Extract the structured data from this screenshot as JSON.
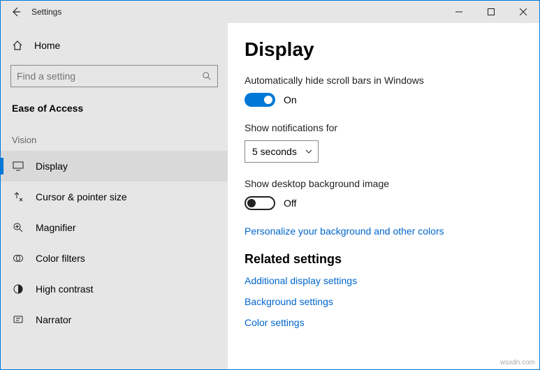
{
  "window": {
    "title": "Settings"
  },
  "sidebar": {
    "home_label": "Home",
    "search_placeholder": "Find a setting",
    "category": "Ease of Access",
    "group": "Vision",
    "items": [
      {
        "label": "Display"
      },
      {
        "label": "Cursor & pointer size"
      },
      {
        "label": "Magnifier"
      },
      {
        "label": "Color filters"
      },
      {
        "label": "High contrast"
      },
      {
        "label": "Narrator"
      }
    ]
  },
  "main": {
    "heading": "Display",
    "hide_scroll_label": "Automatically hide scroll bars in Windows",
    "hide_scroll_state": "On",
    "notif_label": "Show notifications for",
    "notif_value": "5 seconds",
    "bg_label": "Show desktop background image",
    "bg_state": "Off",
    "personalize_link": "Personalize your background and other colors",
    "related_heading": "Related settings",
    "links": [
      "Additional display settings",
      "Background settings",
      "Color settings"
    ]
  },
  "watermark": "wsxdn.com"
}
